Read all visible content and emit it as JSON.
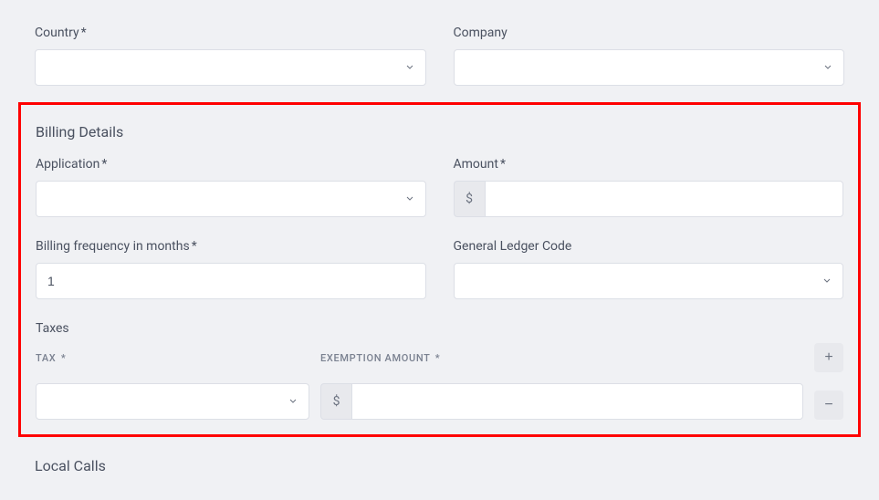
{
  "top": {
    "country_label": "Country",
    "country_required": "*",
    "company_label": "Company"
  },
  "billing": {
    "heading": "Billing Details",
    "application_label": "Application",
    "application_required": "*",
    "amount_label": "Amount",
    "amount_required": "*",
    "amount_currency": "$",
    "freq_label": "Billing frequency in months",
    "freq_required": "*",
    "freq_value": "1",
    "glc_label": "General Ledger Code",
    "taxes_label": "Taxes",
    "tax_col_label": "TAX",
    "tax_col_required": "*",
    "exemption_col_label": "EXEMPTION AMOUNT",
    "exemption_col_required": "*",
    "exemption_currency": "$",
    "add_btn": "+",
    "remove_btn": "−"
  },
  "local_calls": {
    "heading": "Local Calls"
  }
}
